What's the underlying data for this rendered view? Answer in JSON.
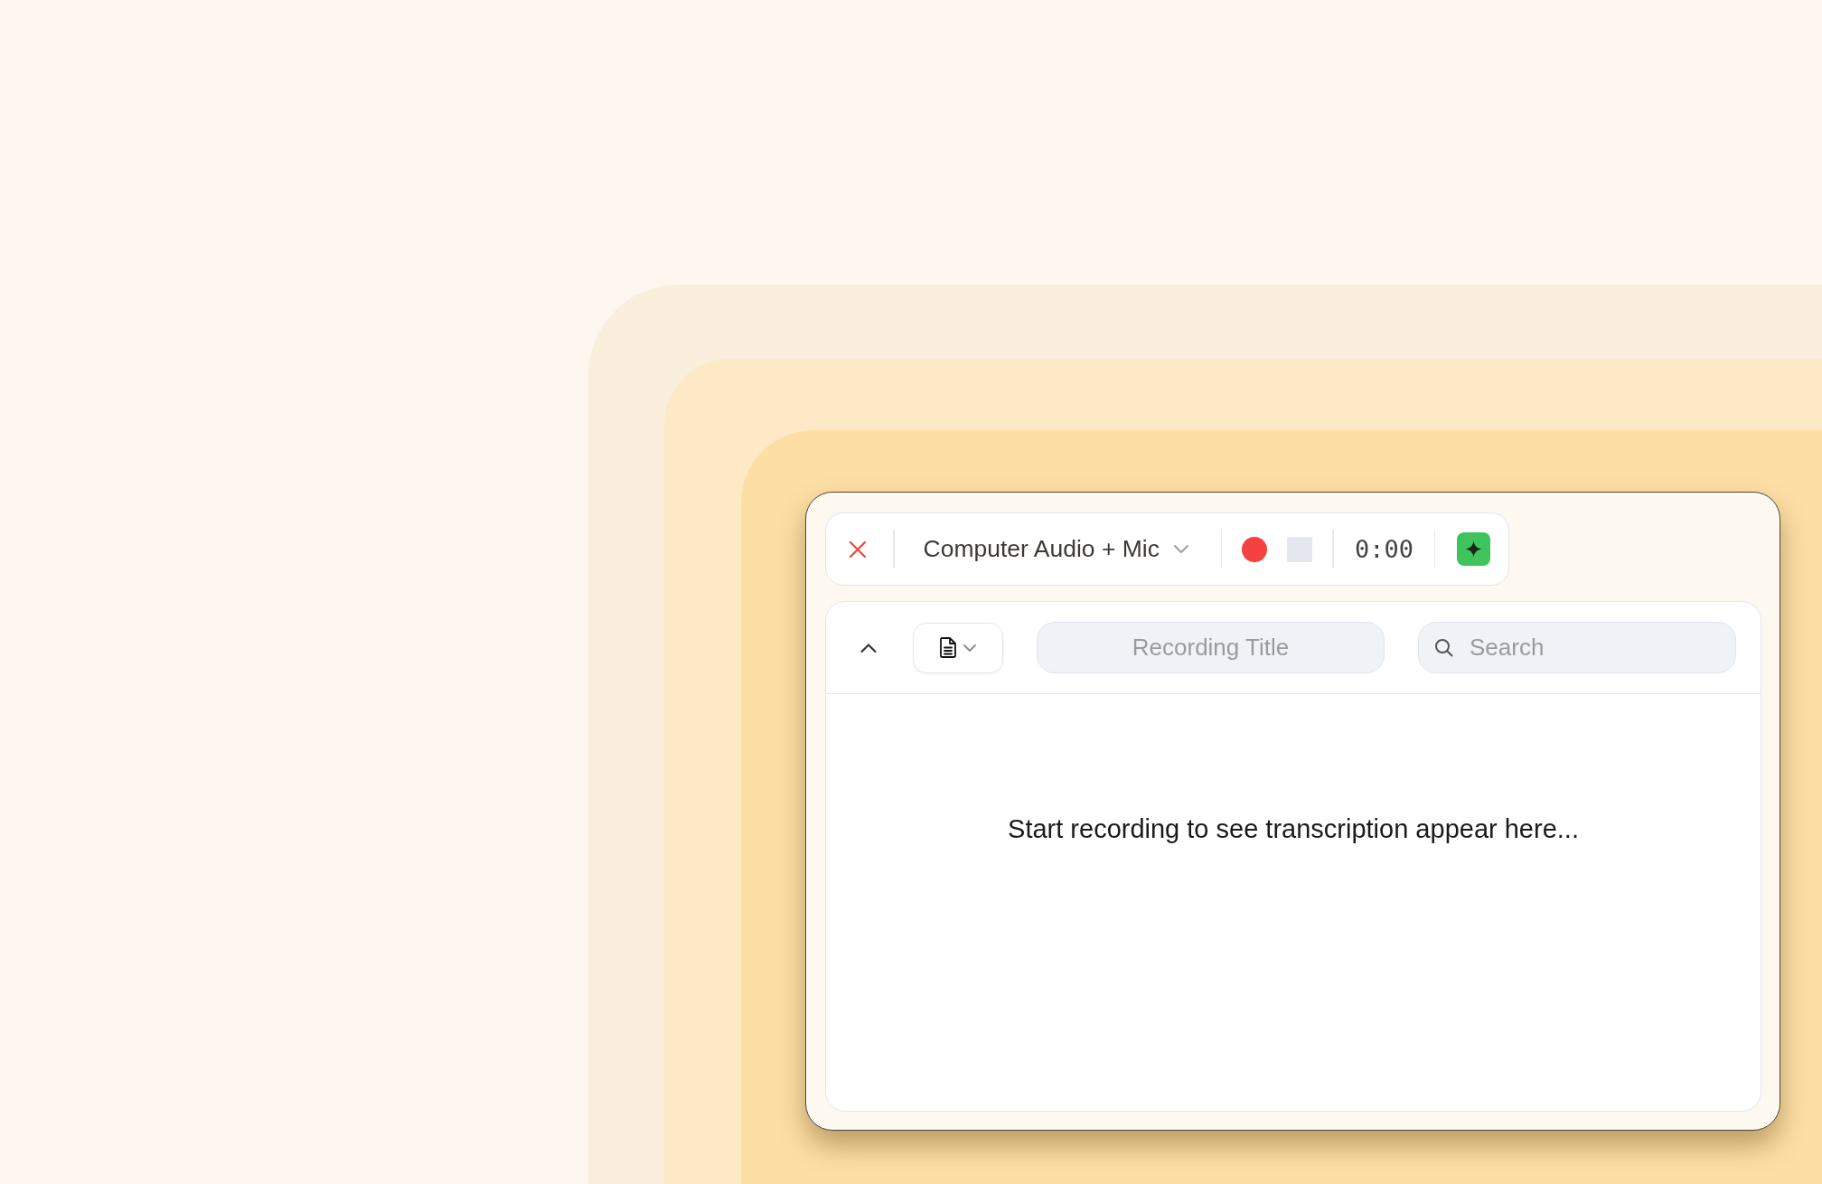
{
  "toolbar": {
    "audio_source": "Computer Audio + Mic",
    "stop_button": {
      "disabled": true
    },
    "timer": "0:00"
  },
  "transcript": {
    "title_field": {
      "placeholder": "Recording Title"
    },
    "search_field": {
      "placeholder": "Search"
    },
    "empty_message": "Start recording to see transcription appear here..."
  }
}
